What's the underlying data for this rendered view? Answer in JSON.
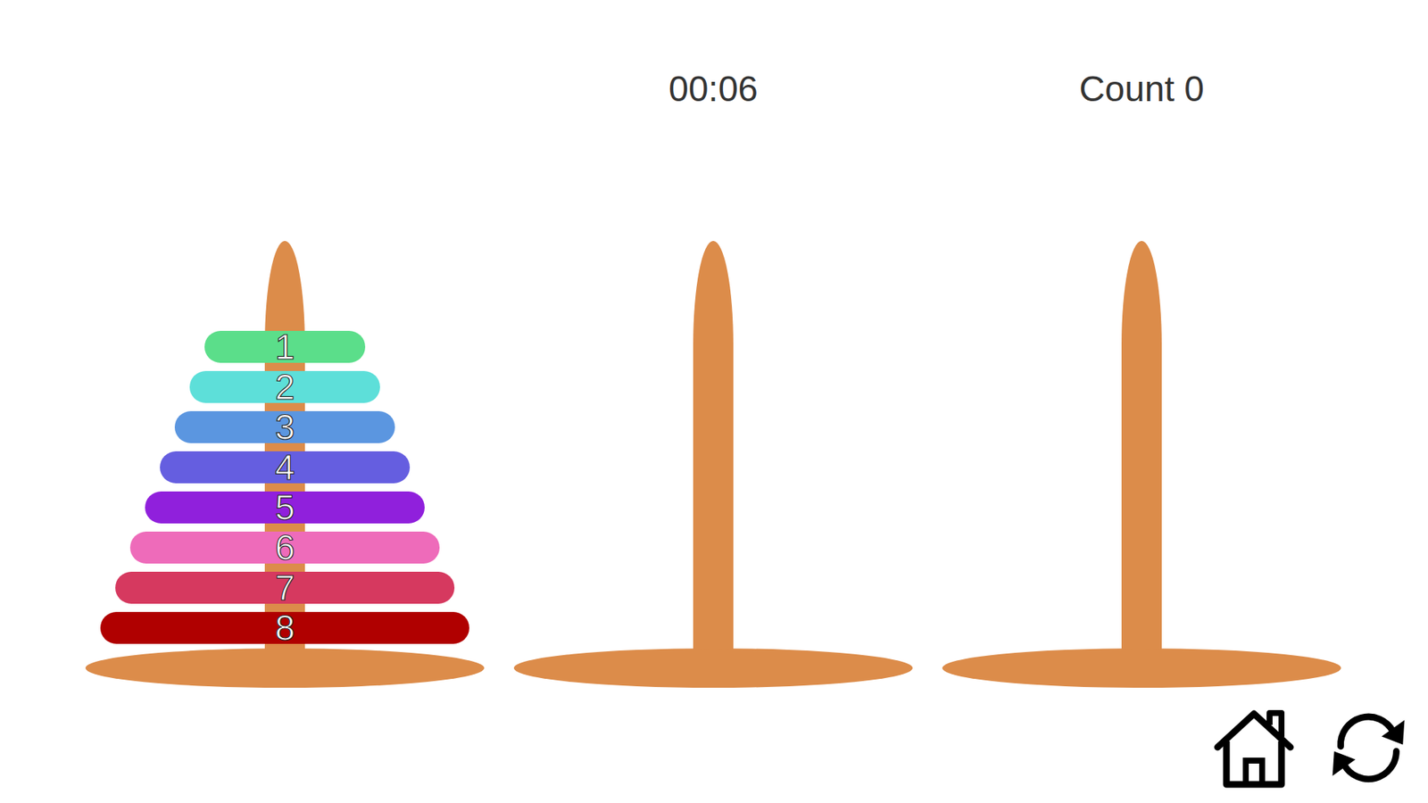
{
  "timer": "00:06",
  "count": "Count 0",
  "pegs": [
    {
      "disks": [
        {
          "label": "1",
          "color": "#5bde8a"
        },
        {
          "label": "2",
          "color": "#5ddfd9"
        },
        {
          "label": "3",
          "color": "#5b96e0"
        },
        {
          "label": "4",
          "color": "#655ee0"
        },
        {
          "label": "5",
          "color": "#9020dc"
        },
        {
          "label": "6",
          "color": "#ee6bba"
        },
        {
          "label": "7",
          "color": "#d6395f"
        },
        {
          "label": "8",
          "color": "#b00000"
        }
      ]
    },
    {
      "disks": []
    },
    {
      "disks": []
    }
  ]
}
